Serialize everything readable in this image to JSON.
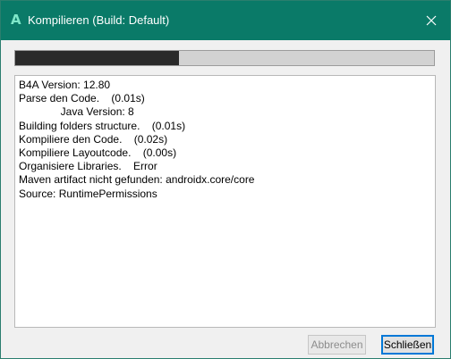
{
  "window": {
    "title": "Kompilieren (Build: Default)",
    "app_icon_glyph": "A",
    "titlebar_color": "#0a7a68",
    "icon_color": "#7fe7c9"
  },
  "progress": {
    "fraction": 0.39,
    "fill_color": "#2a2a2a",
    "track_color": "#d2d2d2"
  },
  "log": {
    "lines": [
      "B4A Version: 12.80",
      "Parse den Code.    (0.01s)",
      "              Java Version: 8",
      "Building folders structure.    (0.01s)",
      "Kompiliere den Code.    (0.02s)",
      "Kompiliere Layoutcode.    (0.00s)",
      "Organisiere Libraries.    Error",
      "Maven artifact nicht gefunden: androidx.core/core",
      "Source: RuntimePermissions"
    ]
  },
  "buttons": {
    "cancel_label": "Abbrechen",
    "close_label": "Schließen"
  },
  "icons": {
    "close": "close-icon",
    "app": "b4a-app-icon"
  }
}
